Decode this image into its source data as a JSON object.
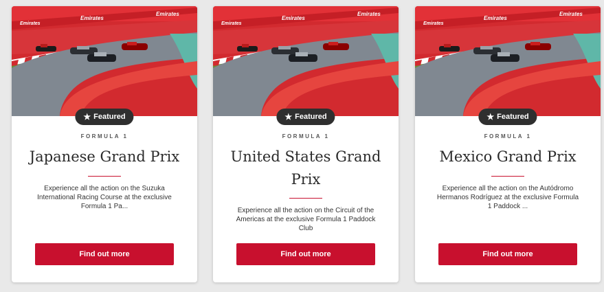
{
  "colors": {
    "accent": "#c8102e",
    "badge_bg": "#2f2f2f",
    "background": "#e9e9e9"
  },
  "cards": [
    {
      "image_alt": "Formula 1 cars racing on track with Emirates Fly Better banners",
      "banner_text": "Emirates FLY BETTER",
      "badge": {
        "icon": "star-icon",
        "label": "Featured"
      },
      "category": "FORMULA 1",
      "title": "Japanese Grand Prix",
      "description": "Experience all the action on the Suzuka International Racing Course at the exclusive Formula 1 Pa...",
      "cta": "Find out more"
    },
    {
      "image_alt": "Formula 1 cars racing on track with Emirates Fly Better banners",
      "banner_text": "Emirates FLY BETTER",
      "badge": {
        "icon": "star-icon",
        "label": "Featured"
      },
      "category": "FORMULA 1",
      "title": "United States Grand Prix",
      "description": "Experience all the action on the Circuit of the Americas at the exclusive Formula 1 Paddock Club",
      "cta": "Find out more"
    },
    {
      "image_alt": "Formula 1 cars racing on track with Emirates Fly Better banners",
      "banner_text": "Emirates FLY BETTER",
      "badge": {
        "icon": "star-icon",
        "label": "Featured"
      },
      "category": "FORMULA 1",
      "title": "Mexico Grand Prix",
      "description": "Experience all the action on the Autódromo Hermanos Rodríguez at the exclusive Formula 1 Paddock ...",
      "cta": "Find out more"
    }
  ]
}
